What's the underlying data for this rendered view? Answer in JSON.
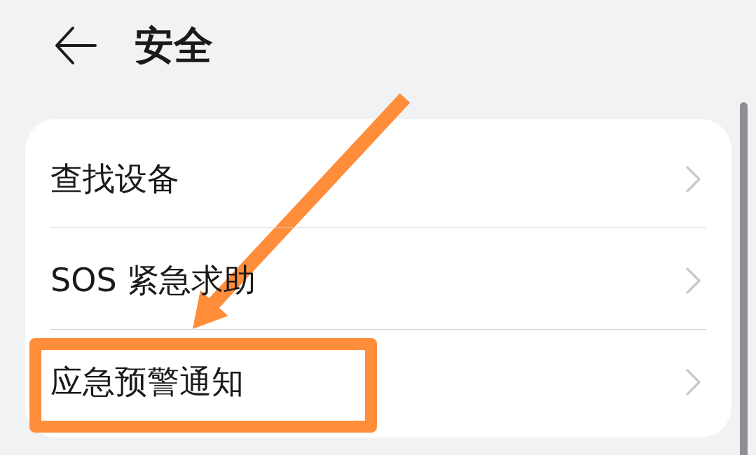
{
  "header": {
    "title": "安全"
  },
  "items": [
    {
      "label": "查找设备",
      "highlighted": false
    },
    {
      "label": "SOS 紧急求助",
      "highlighted": false
    },
    {
      "label": "应急预警通知",
      "highlighted": true
    }
  ]
}
